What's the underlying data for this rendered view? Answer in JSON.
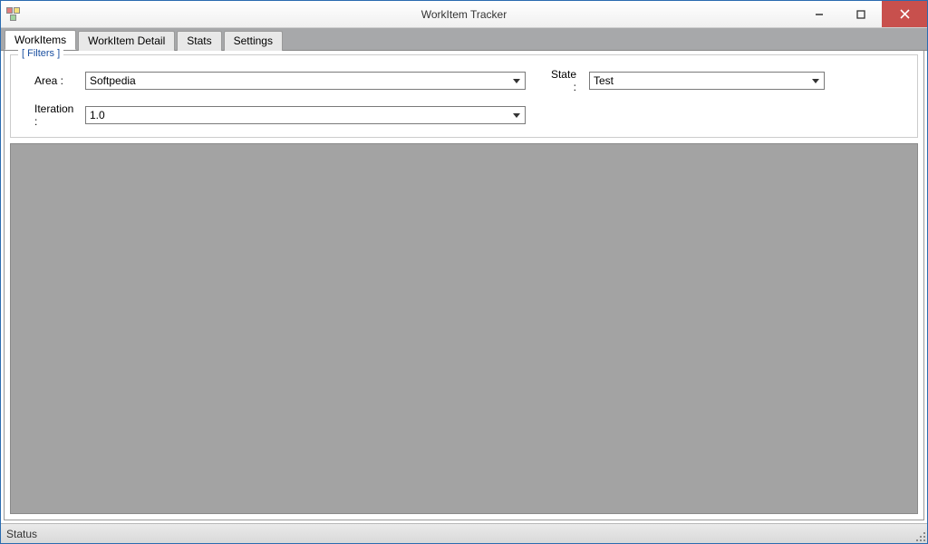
{
  "window": {
    "title": "WorkItem Tracker"
  },
  "tabs": [
    {
      "label": "WorkItems"
    },
    {
      "label": "WorkItem Detail"
    },
    {
      "label": "Stats"
    },
    {
      "label": "Settings"
    }
  ],
  "filters": {
    "legend": "[ Filters ]",
    "area_label": "Area :",
    "area_value": "Softpedia",
    "state_label": "State :",
    "state_value": "Test",
    "iteration_label": "Iteration :",
    "iteration_value": "1.0"
  },
  "statusbar": {
    "text": "Status"
  }
}
